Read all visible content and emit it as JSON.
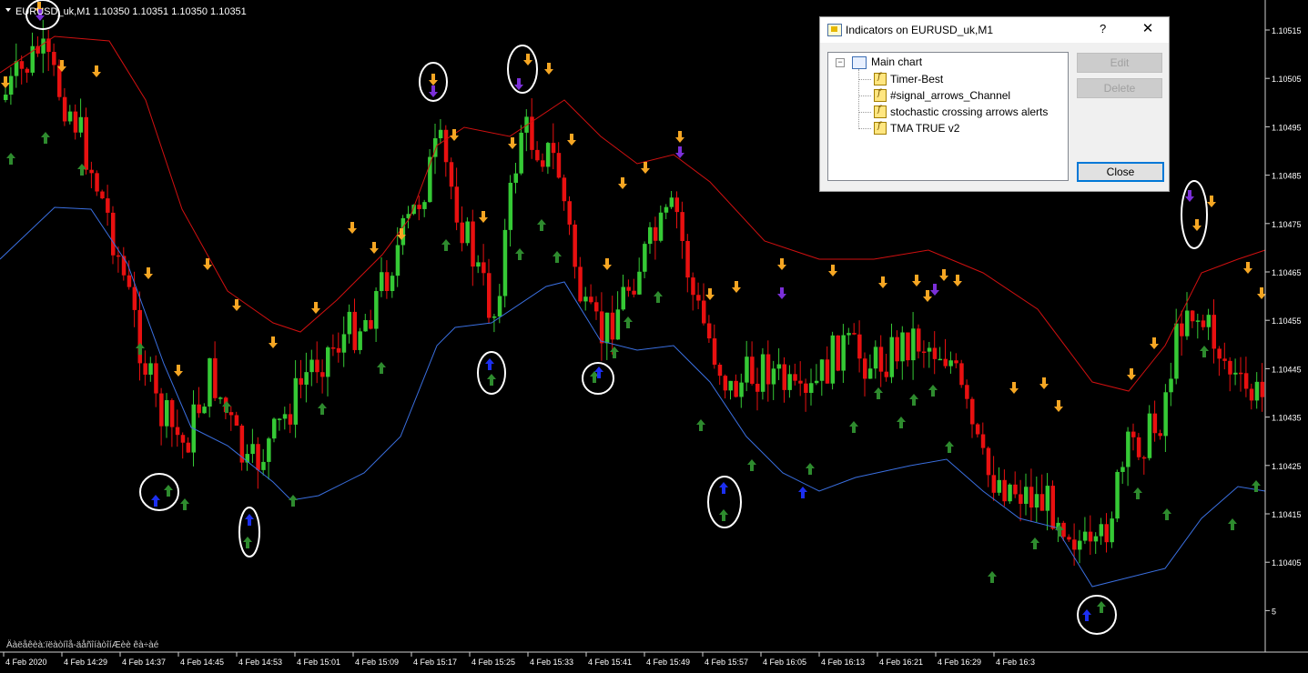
{
  "chart": {
    "header_text": "EURUSD_uk,M1  1.10350 1.10351 1.10350 1.10351",
    "status_text": "Äàëåêèà:ïëàòíîå-äåñîíàòîíÆèè êà÷àé",
    "price_labels": [
      "1.10515",
      "1.10505",
      "1.10495",
      "1.10485",
      "1.10475",
      "1.10465",
      "1.10455",
      "1.10445",
      "1.10435",
      "1.10425",
      "1.10415",
      "1.10405",
      "5"
    ],
    "time_labels": [
      "4 Feb 2020",
      "4 Feb 14:29",
      "4 Feb 14:37",
      "4 Feb 14:45",
      "4 Feb 14:53",
      "4 Feb 15:01",
      "4 Feb 15:09",
      "4 Feb 15:17",
      "4 Feb 15:25",
      "4 Feb 15:33",
      "4 Feb 15:41",
      "4 Feb 15:49",
      "4 Feb 15:57",
      "4 Feb 16:05",
      "4 Feb 16:13",
      "4 Feb 16:21",
      "4 Feb 16:29",
      "4 Feb 16:3"
    ],
    "colors": {
      "bull": "#35c935",
      "bear": "#e81010",
      "upper_band": "#d01010",
      "lower_band": "#3a6fe0",
      "arrow_up": "#2e8b2e",
      "arrow_down": "#f5a623",
      "arrow_purple": "#7b2fd8",
      "arrow_blue": "#1c2ff0"
    }
  },
  "dialog": {
    "title": "Indicators on EURUSD_uk,M1",
    "help_label": "?",
    "close_icon": "✕",
    "tree_root": "Main chart",
    "indicators": [
      "Timer-Best",
      "#signal_arrows_Channel",
      "stochastic crossing arrows alerts",
      "TMA TRUE v2"
    ],
    "buttons": {
      "edit": "Edit",
      "delete": "Delete",
      "close": "Close"
    }
  }
}
